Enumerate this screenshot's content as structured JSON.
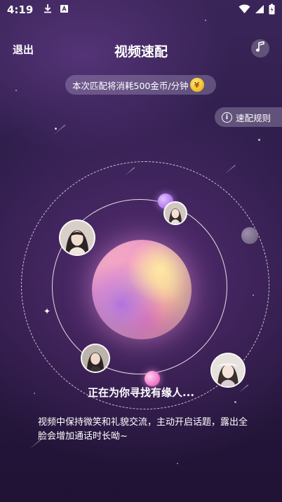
{
  "status_bar": {
    "time": "4:19"
  },
  "nav": {
    "exit_label": "退出",
    "title": "视频速配"
  },
  "cost_notice": {
    "text": "本次匹配将消耗500金币/分钟",
    "coin_glyph": "¥"
  },
  "rules_button": {
    "label": "速配规则"
  },
  "matching": {
    "status_text": "正在为你寻找有缘人...",
    "tips": "视频中保持微笑和礼貌交流，主动开启话题，露出全脸会增加通话时长呦~"
  },
  "colors": {
    "background_top": "#3a2558",
    "background_bottom": "#1f1233",
    "coin_gold": "#f5c431"
  },
  "icons": [
    "download-icon",
    "sim-icon",
    "wifi-icon",
    "signal-icon",
    "battery-icon",
    "music-note-icon",
    "info-icon"
  ]
}
